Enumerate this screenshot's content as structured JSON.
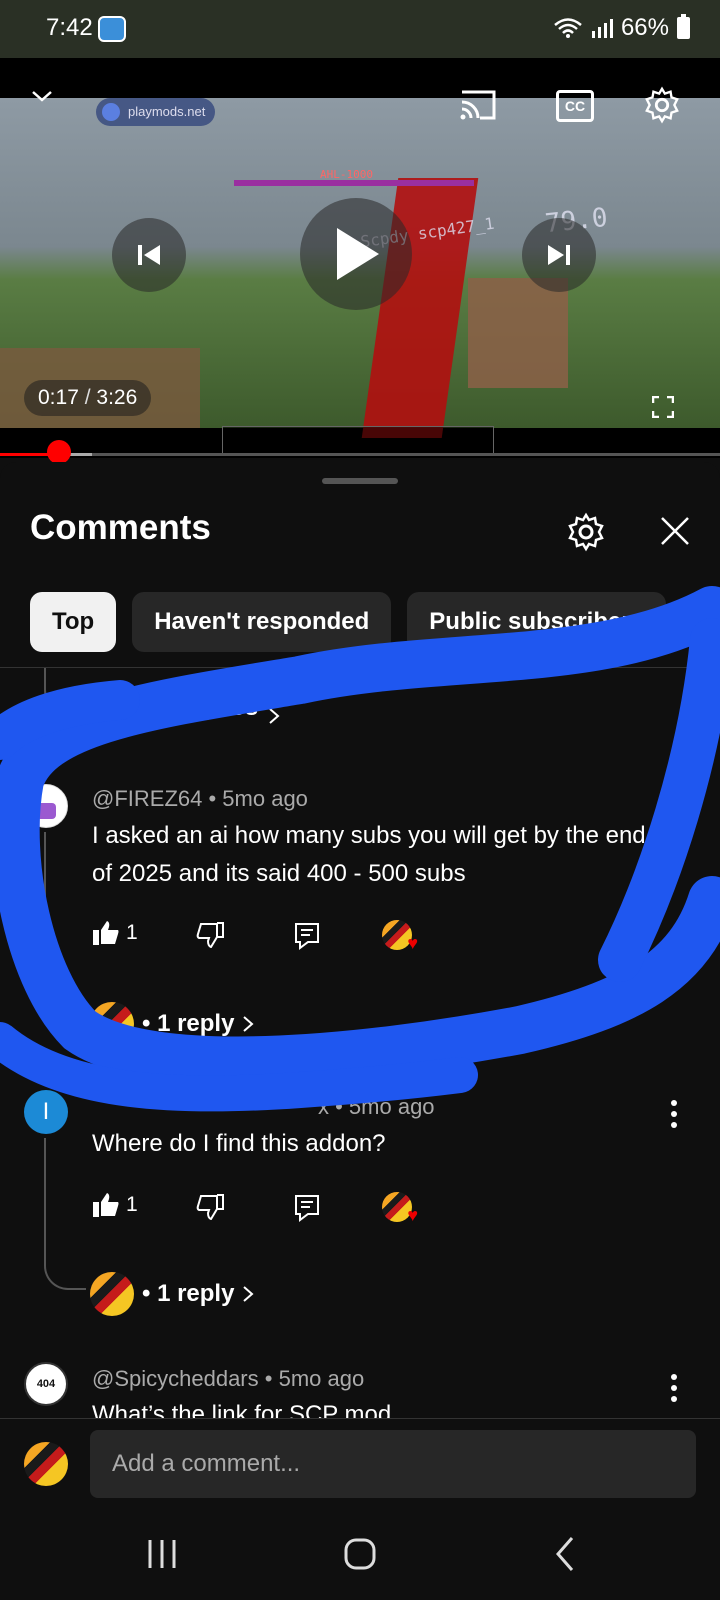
{
  "status_bar": {
    "time": "7:42",
    "battery": "66%"
  },
  "player": {
    "watermark": "playmods.net",
    "boss_label": "AHL-1000",
    "in_game_text": "Scpdy scp427_1",
    "in_game_number": "79.0",
    "cc_label": "CC",
    "current_time": "0:17",
    "separator": " / ",
    "duration": "3:26",
    "progress_fraction": 0.082
  },
  "comments_panel": {
    "title": "Comments",
    "chips": [
      "Top",
      "Haven't responded",
      "Public subscribers"
    ],
    "partial_reply_text": "eplies",
    "comments": [
      {
        "author": "@FIREZ64",
        "age": "5mo ago",
        "meta_sep": " • ",
        "text": "I asked an ai how many subs you will get by the end of 2025 and its said 400 - 500 subs",
        "likes": "1",
        "replies": "• 1 reply"
      },
      {
        "author_partial": "x • 5mo ago",
        "avatar_letter": "I",
        "text": "Where do I find this addon?",
        "likes": "1",
        "replies": "• 1 reply"
      },
      {
        "author": "@Spicycheddars",
        "age": "5mo ago",
        "meta_sep": " • ",
        "avatar_text": "404",
        "text": "What’s the link for SCP mod"
      }
    ]
  },
  "add_comment": {
    "placeholder": "Add a comment..."
  },
  "colors": {
    "background": "#0f0f0f",
    "chip_active": "#f1f1f1",
    "chip": "#272727",
    "progress": "#ff0000",
    "annotation_blue": "#1f57f0"
  }
}
